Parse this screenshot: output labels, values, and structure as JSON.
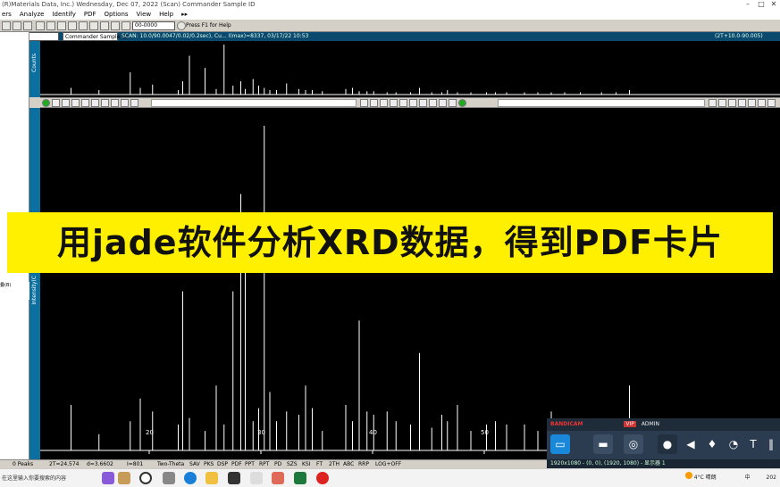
{
  "window": {
    "title": "(R)Materials Data, Inc.) Wednesday, Dec 07, 2022 (Scan) Commander Sample ID",
    "controls": [
      "–",
      "□",
      "✕"
    ]
  },
  "menu": [
    "ers",
    "Analyze",
    "Identify",
    "PDF",
    "Options",
    "View",
    "Help",
    "▸▸"
  ],
  "toolbar": {
    "combo_value": "00-0000",
    "hint": "Press F1 for Help"
  },
  "upper_header": {
    "file_combo": "1.raw",
    "sample_combo": "Commander Sample ID",
    "scan_info": "SCAN: 10.0/90.0047/0.02/0.2sec), Cu... I(max)=8337, 03/17/22 10:53",
    "right_info": "(2T+10.0-90.005)"
  },
  "upper_plot": {
    "ylabel": "Counts"
  },
  "main_plot": {
    "ylabel": "Intensity(C",
    "ticks": [
      {
        "value": 20,
        "label": "20"
      },
      {
        "value": 30,
        "label": "30"
      },
      {
        "value": 40,
        "label": "40"
      },
      {
        "value": 50,
        "label": "50"
      }
    ]
  },
  "chart_data": {
    "type": "line",
    "title": "",
    "xlabel": "",
    "ylabel": "Intensity(C",
    "xlim": [
      10,
      77
    ],
    "ylim": [
      0,
      100
    ],
    "series": [
      {
        "peaks_x": [
          13.0,
          15.5,
          18.3,
          19.2,
          20.3,
          22.6,
          23.0,
          23.6,
          25.0,
          26.0,
          26.7,
          27.5,
          28.2,
          28.6,
          29.3,
          29.8,
          30.3,
          30.8,
          31.4,
          32.3,
          33.4,
          34.0,
          34.6,
          35.5,
          37.6,
          38.2,
          38.8,
          39.5,
          40.1,
          41.3,
          42.1,
          43.4,
          44.2,
          45.3,
          46.2,
          46.7,
          47.6,
          48.8,
          50.2,
          51.0,
          52.0,
          53.6,
          54.8,
          56.0,
          57.2,
          58.6,
          60.5,
          61.8,
          63.0
        ],
        "peaks_y": [
          14,
          5,
          9,
          16,
          12,
          8,
          49,
          10,
          6,
          20,
          8,
          49,
          79,
          58,
          9,
          13,
          100,
          18,
          9,
          12,
          11,
          20,
          13,
          6,
          14,
          9,
          40,
          12,
          11,
          12,
          9,
          8,
          30,
          7,
          11,
          9,
          14,
          6,
          8,
          9,
          8,
          8,
          6,
          12,
          6,
          7,
          6,
          6,
          20
        ]
      }
    ],
    "upper_peaks_y": [
      6,
      4,
      20,
      6,
      9,
      4,
      12,
      35,
      24,
      5,
      45,
      8,
      12,
      5,
      14,
      8,
      6,
      4,
      4,
      10,
      5,
      4,
      4,
      3,
      5,
      6,
      3,
      3,
      3,
      2,
      2,
      2,
      6,
      2,
      2,
      4,
      2,
      2,
      2,
      2,
      2,
      2,
      2,
      2,
      2,
      2,
      2,
      2,
      4
    ]
  },
  "banner": {
    "text": "用jade软件分析XRD数据，得到PDF卡片"
  },
  "left_info": {
    "line": "叠(B)"
  },
  "status": {
    "peaks": "0 Peaks",
    "twotheta": "2T=24.574",
    "d": "d=3.6602",
    "i": "I=801",
    "mode": "Two-Theta",
    "buttons": [
      "SAV",
      "PKS",
      "DSP",
      "PDF",
      "PPT",
      "RPT",
      "PD",
      "SZS",
      "KSI",
      "FT",
      "2TH",
      "ABC",
      "RRP",
      "LOG+OFF"
    ]
  },
  "taskbar": {
    "search": "在这里输入你要搜索的内容",
    "weather": "4°C 晴朗",
    "ime": "中",
    "clock": "202"
  },
  "bandicam": {
    "brand": "BANDICAM",
    "tag": "VIP",
    "admin": "ADMIN",
    "resolution": "1920x1080 - (0, 0), (1920, 1080) - 显示器 1"
  },
  "colors": {
    "plot_bg": "#000000",
    "trace": "#ffffff",
    "banner_bg": "#fff000",
    "header_bg": "#0b4a6e"
  }
}
